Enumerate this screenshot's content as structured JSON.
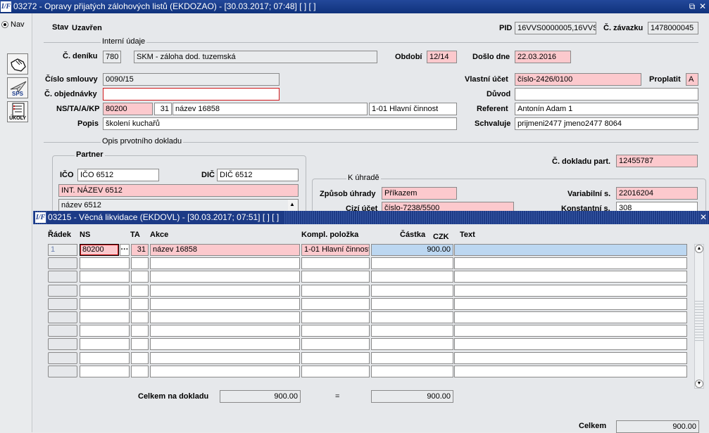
{
  "window": {
    "title": "03272 - Opravy přijatých zálohových listů (EKDOZAO) - [30.03.2017; 07:48]  [ ]  [ ]",
    "app_icon": "I/F"
  },
  "sidebar": {
    "nav_label": "Nav",
    "tool_sps_label": "SPS",
    "tool_ukoly_label": "ÚKOLY"
  },
  "header": {
    "stav_label": "Stav",
    "stav_value": "Uzavřen",
    "pid_label": "PID",
    "pid_value": "16VVS0000005,16VVS",
    "zavazku_label": "Č. závazku",
    "zavazku_value": "1478000045"
  },
  "interni": {
    "section_title": "Interní údaje",
    "denik_label": "Č. deníku",
    "denik_value": "780",
    "denik_desc": "SKM - záloha dod. tuzemská",
    "obdobi_label": "Období",
    "obdobi_value": "12/14",
    "doslo_label": "Došlo dne",
    "doslo_value": "22.03.2016",
    "smlouvy_label": "Číslo smlouvy",
    "smlouvy_value": "0090/15",
    "objednavky_label": "Č. objednávky",
    "objednavky_value": "",
    "nstaakp_label": "NS/TA/A/KP",
    "ns_value": "80200",
    "ta_value": "31",
    "akce_value": "název 16858",
    "kp_value": "1-01 Hlavní činnost",
    "popis_label": "Popis",
    "popis_value": "školení kuchařů",
    "vlastni_ucet_label": "Vlastní účet",
    "vlastni_ucet_value": "číslo-2426/0100",
    "proplatit_label": "Proplatit",
    "proplatit_value": "A",
    "duvod_label": "Důvod",
    "duvod_value": "",
    "referent_label": "Referent",
    "referent_value": "Antonín Adam 1",
    "schvaluje_label": "Schvaluje",
    "schvaluje_value": "prijmeni2477 jmeno2477 8064"
  },
  "opis": {
    "section_title": "Opis prvotního dokladu",
    "partner_title": "Partner",
    "ico_label": "IČO",
    "ico_value": "IČO 6512",
    "dic_label": "DIČ",
    "dic_value": "DIČ 6512",
    "int_nazev": "INT. NÁZEV 6512",
    "nazev": "název 6512",
    "doklad_part_label": "Č. dokladu part.",
    "doklad_part_value": "12455787",
    "k_uhrade_title": "K úhradě",
    "zpusob_label": "Způsob úhrady",
    "zpusob_value": "Příkazem",
    "variabilni_label": "Variabilní s.",
    "variabilni_value": "22016204",
    "cizi_ucet_label": "Cizí účet",
    "cizi_ucet_value": "číslo-7238/5500",
    "konstantni_label": "Konstantní s.",
    "konstantni_value": "308"
  },
  "subwindow": {
    "title": "03215 - Věcná likvidace (EKDOVL) - [30.03.2017; 07:51]  [ ]  [ ]",
    "app_icon": "I/F",
    "columns": {
      "radek": "Řádek",
      "ns": "NS",
      "ta": "TA",
      "akce": "Akce",
      "kompl": "Kompl. položka",
      "castka": "Částka",
      "currency": "CZK",
      "text": "Text"
    },
    "row1": {
      "radek": "1",
      "ns": "80200",
      "lov_button": "···",
      "ta": "31",
      "akce": "název 16858",
      "kompl": "1-01 Hlavní činnost",
      "castka": "900.00",
      "text": ""
    },
    "celkem_label": "Celkem na dokladu",
    "celkem_value": "900.00",
    "equals": "=",
    "celkem_value2": "900.00"
  },
  "footer": {
    "celkem_label": "Celkem",
    "celkem_value": "900.00"
  }
}
